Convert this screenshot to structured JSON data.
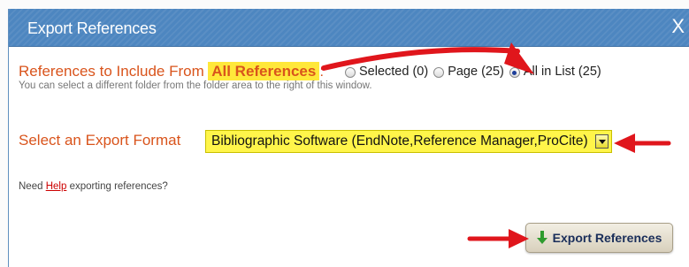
{
  "dialog": {
    "title": "Export References",
    "close_label": "X"
  },
  "include": {
    "label": "References to Include From",
    "highlight": "All References",
    "colon": ":",
    "options": [
      {
        "label": "Selected (0)",
        "checked": false
      },
      {
        "label": "Page (25)",
        "checked": false
      },
      {
        "label": "All in List (25)",
        "checked": true
      }
    ],
    "hint": "You can select a different folder from the folder area to the right of this window."
  },
  "format": {
    "label": "Select an Export Format",
    "selected": "Bibliographic Software (EndNote,Reference Manager,ProCite)"
  },
  "help": {
    "prefix": "Need",
    "link": "Help",
    "suffix": "exporting references?"
  },
  "export_button": {
    "label": "Export References",
    "icon": "down-arrow-icon"
  },
  "colors": {
    "titlebar": "#4d86c0",
    "label_orange": "#d9541c",
    "highlight_yellow": "#ffe83a",
    "annotation_red": "#e0161c",
    "icon_green": "#2e9b2e"
  }
}
